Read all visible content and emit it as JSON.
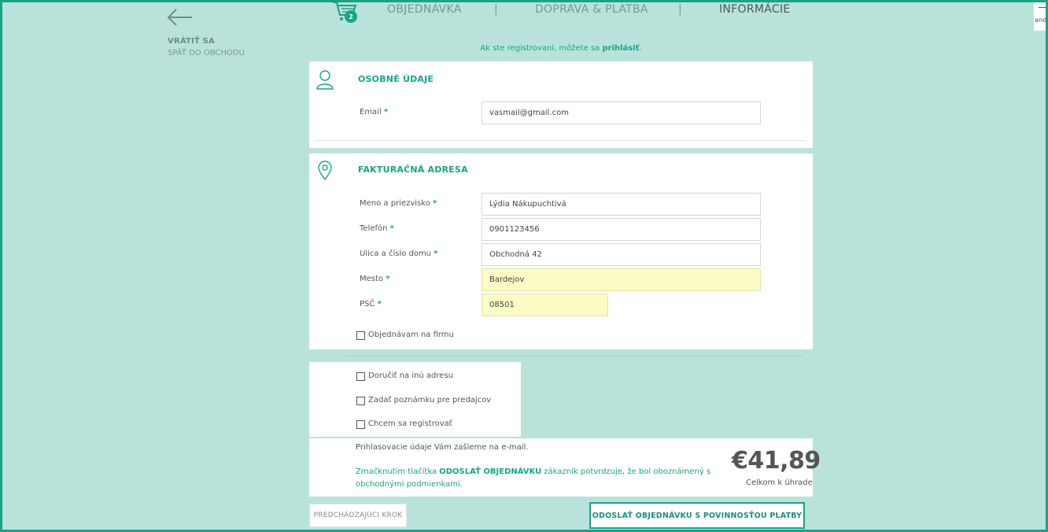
{
  "back": {
    "title": "VRÁTIŤ SA",
    "subtitle": "SPÄŤ DO OBCHODU"
  },
  "cart": {
    "count": "2"
  },
  "steps": [
    {
      "label": "OBJEDNÁVKA"
    },
    {
      "label": "DOPRAVA & PLATBA"
    },
    {
      "label": "INFORMÁCIE"
    }
  ],
  "separator": "|",
  "login_note": {
    "prefix": "Ak ste registrovaní, môžete sa ",
    "link": "prihlásiť",
    "suffix": "."
  },
  "personal": {
    "title": "OSOBNÉ ÚDAJE",
    "email_label": "Email",
    "email_value": "vasmail@gmail.com"
  },
  "required_mark": "*",
  "billing": {
    "title": "FAKTURAČNÁ ADRESA",
    "fields": [
      {
        "label": "Meno a priezvisko",
        "value": "Lýdia Nákupuchtivá"
      },
      {
        "label": "Telefón",
        "value": "0901123456"
      },
      {
        "label": "Ulica a číslo domu",
        "value": "Obchodná 42"
      },
      {
        "label": "Mesto",
        "value": "Bardejov"
      },
      {
        "label": "PSČ",
        "value": "08501"
      }
    ],
    "company_checkbox": "Objednávam na firmu"
  },
  "options": [
    "Doručiť na inú adresu",
    "Zadať poznámku pre predajcov",
    "Chcem sa registrovať"
  ],
  "summary": {
    "info": "Prihlasovacie údaje Vám zašleme na e-mail.",
    "terms_prefix": "Zmačknutím tlačítka ",
    "terms_bold": "ODOSLAŤ OBJEDNÁVKU",
    "terms_suffix": " zákazník potvrdzuje, že bol oboznámený s obchodnými podmienkami.",
    "price": "€41,89",
    "total_label": "Celkom k úhrade"
  },
  "buttons": {
    "prev": "PREDCHÁDZAJÚCI KROK",
    "submit": "ODOSLAŤ OBJEDNÁVKU S POVINNOSŤOU PLATBY"
  },
  "side_widget": {
    "text": "and"
  },
  "colors": {
    "accent": "#1aa386",
    "background": "#b9e3da",
    "autofill": "#fbfbc6"
  }
}
